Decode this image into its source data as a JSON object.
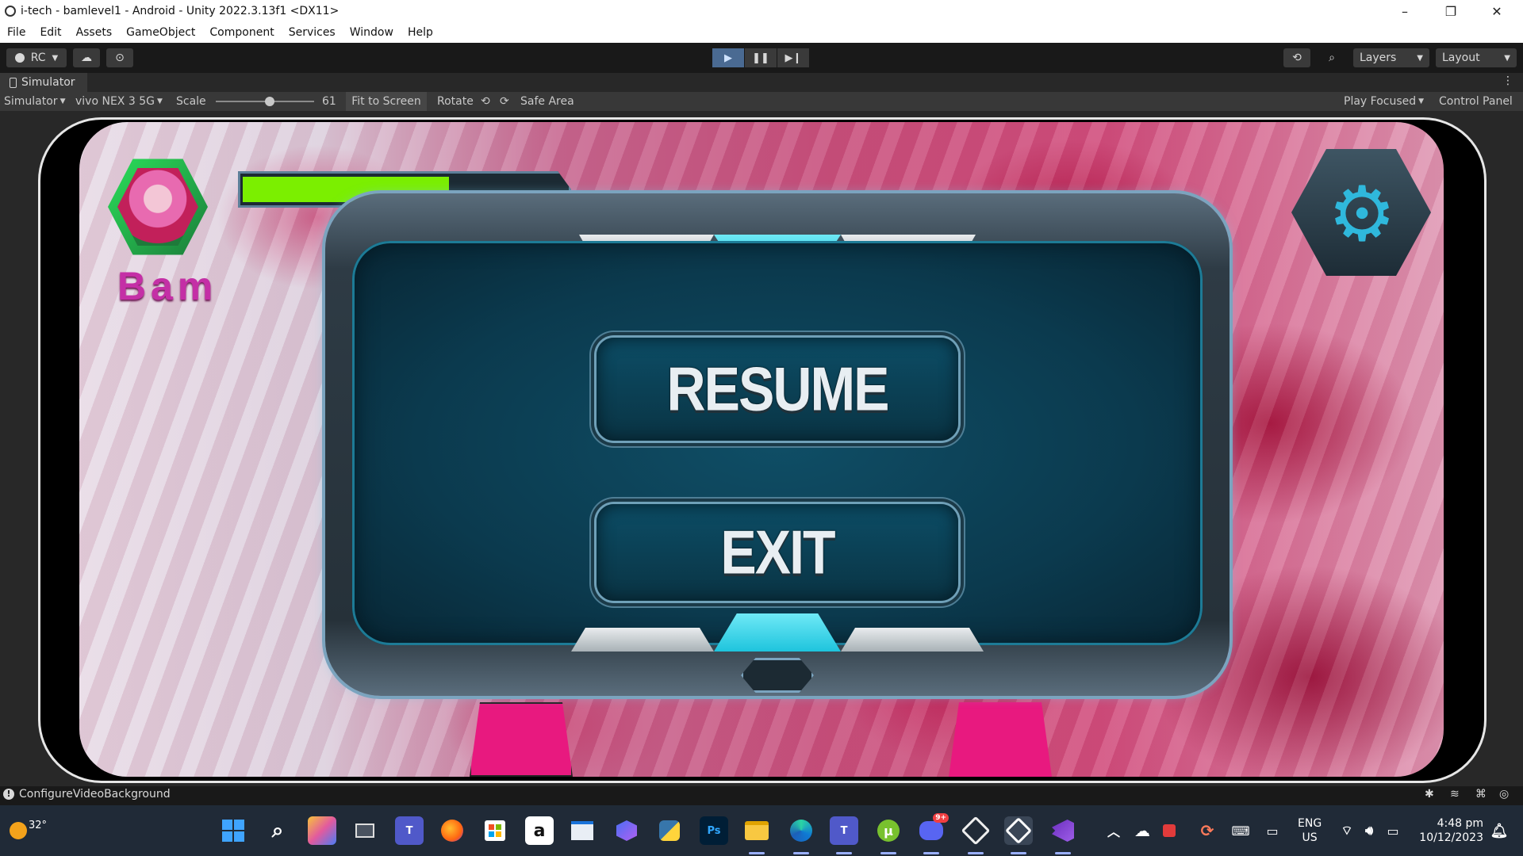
{
  "window": {
    "title": "i-tech - bamlevel1 - Android - Unity 2022.3.13f1 <DX11>",
    "controls": {
      "minimize": "–",
      "maximize": "❐",
      "close": "✕"
    }
  },
  "menu": [
    "File",
    "Edit",
    "Assets",
    "GameObject",
    "Component",
    "Services",
    "Window",
    "Help"
  ],
  "toolbar": {
    "account_label": "RC",
    "layers_label": "Layers",
    "layout_label": "Layout",
    "play_state": "playing"
  },
  "tab": {
    "label": "Simulator",
    "more": "⋮"
  },
  "simulator_bar": {
    "mode": "Simulator",
    "device": "vivo NEX 3 5G",
    "scale_label": "Scale",
    "scale_value": "61",
    "scale_fraction": 0.55,
    "fit_label": "Fit to Screen",
    "rotate_label": "Rotate",
    "safe_area_label": "Safe Area",
    "play_focused_label": "Play Focused",
    "control_panel_label": "Control Panel"
  },
  "game": {
    "player_name": "Bam",
    "health_fraction": 0.65,
    "colors": {
      "health": "#7bef00",
      "name": "#c42fa6",
      "panel": "#0e4a61",
      "accent": "#2fd4e8"
    },
    "pause_menu": {
      "resume_label": "RESUME",
      "exit_label": "EXIT"
    }
  },
  "status": {
    "message": "ConfigureVideoBackground"
  },
  "taskbar": {
    "weather_temp": "32°",
    "language": "ENG",
    "region": "US",
    "time": "4:48 pm",
    "date": "10/12/2023",
    "discord_badge": "9+",
    "photoshop_label": "Ps",
    "teams_label": "T"
  }
}
